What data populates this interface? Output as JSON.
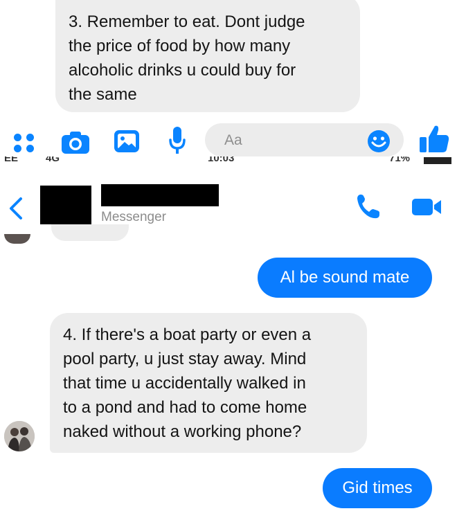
{
  "top_pane": {
    "message_3": [
      "3. Remember to eat. Dont judge",
      "the price of food by how many",
      "alcoholic drinks u could buy for",
      "the same"
    ],
    "composer": {
      "placeholder": "Aa",
      "icons": [
        "apps-icon",
        "camera-icon",
        "image-icon",
        "mic-icon",
        "emoji-icon",
        "thumbs-up-icon"
      ]
    }
  },
  "status_bar": {
    "carrier": "EE",
    "network": "4G",
    "time": "10:03",
    "battery": "71%"
  },
  "header": {
    "subtitle": "Messenger",
    "icons": [
      "back-icon",
      "call-icon",
      "video-call-icon"
    ]
  },
  "messages": {
    "outgoing_1": "Al be sound mate",
    "incoming_4": [
      "4. If there's a boat party or even a",
      "pool party, u just stay away. Mind",
      "that time u accidentally walked in",
      "to a pond and had to come home",
      "naked without a working phone?"
    ],
    "outgoing_2": "Gid times"
  },
  "colors": {
    "accent": "#0a84ff",
    "outgoing_bubble": "#0a7cff",
    "incoming_bubble": "#ededed"
  }
}
